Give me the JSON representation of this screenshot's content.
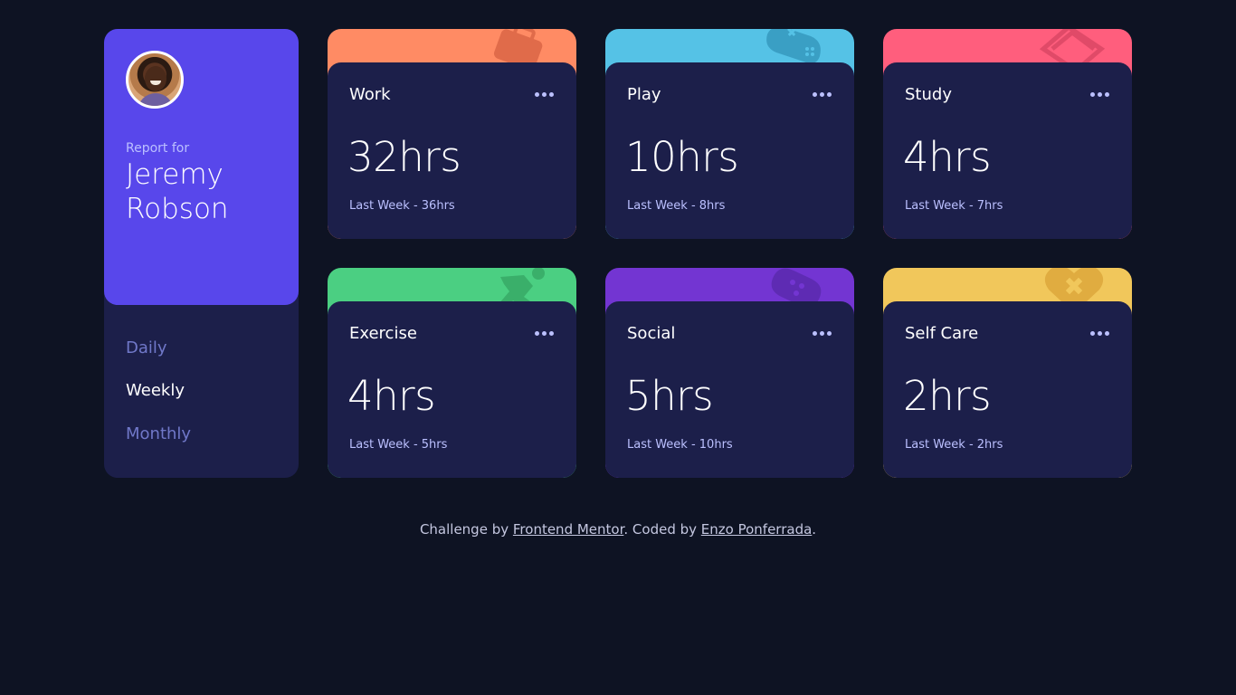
{
  "profile": {
    "report_for": "Report for",
    "name": "Jeremy Robson",
    "timeframes": [
      "Daily",
      "Weekly",
      "Monthly"
    ],
    "active_timeframe": "Weekly"
  },
  "cards": [
    {
      "title": "Work",
      "current": "32hrs",
      "previous": "Last Week - 36hrs",
      "color": "#ff8b64",
      "icon": "briefcase-icon"
    },
    {
      "title": "Play",
      "current": "10hrs",
      "previous": "Last Week - 8hrs",
      "color": "#55c2e6",
      "icon": "gamepad-icon"
    },
    {
      "title": "Study",
      "current": "4hrs",
      "previous": "Last Week - 7hrs",
      "color": "#ff5e7d",
      "icon": "books-icon"
    },
    {
      "title": "Exercise",
      "current": "4hrs",
      "previous": "Last Week - 5hrs",
      "color": "#4bcf82",
      "icon": "running-icon"
    },
    {
      "title": "Social",
      "current": "5hrs",
      "previous": "Last Week - 10hrs",
      "color": "#7335d2",
      "icon": "social-icon"
    },
    {
      "title": "Self Care",
      "current": "2hrs",
      "previous": "Last Week - 2hrs",
      "color": "#f1c75b",
      "icon": "heart-bandage-icon"
    }
  ],
  "footer": {
    "prefix": "Challenge by",
    "link1": "Frontend Mentor",
    "middle": ". Coded by",
    "link2": "Enzo Ponferrada",
    "suffix": "."
  },
  "colors": {
    "background": "#0e1323",
    "card": "#1c1f4a",
    "profile_accent": "#5847eb",
    "muted_text": "#bbc0ff",
    "inactive_link": "#7078c9"
  }
}
